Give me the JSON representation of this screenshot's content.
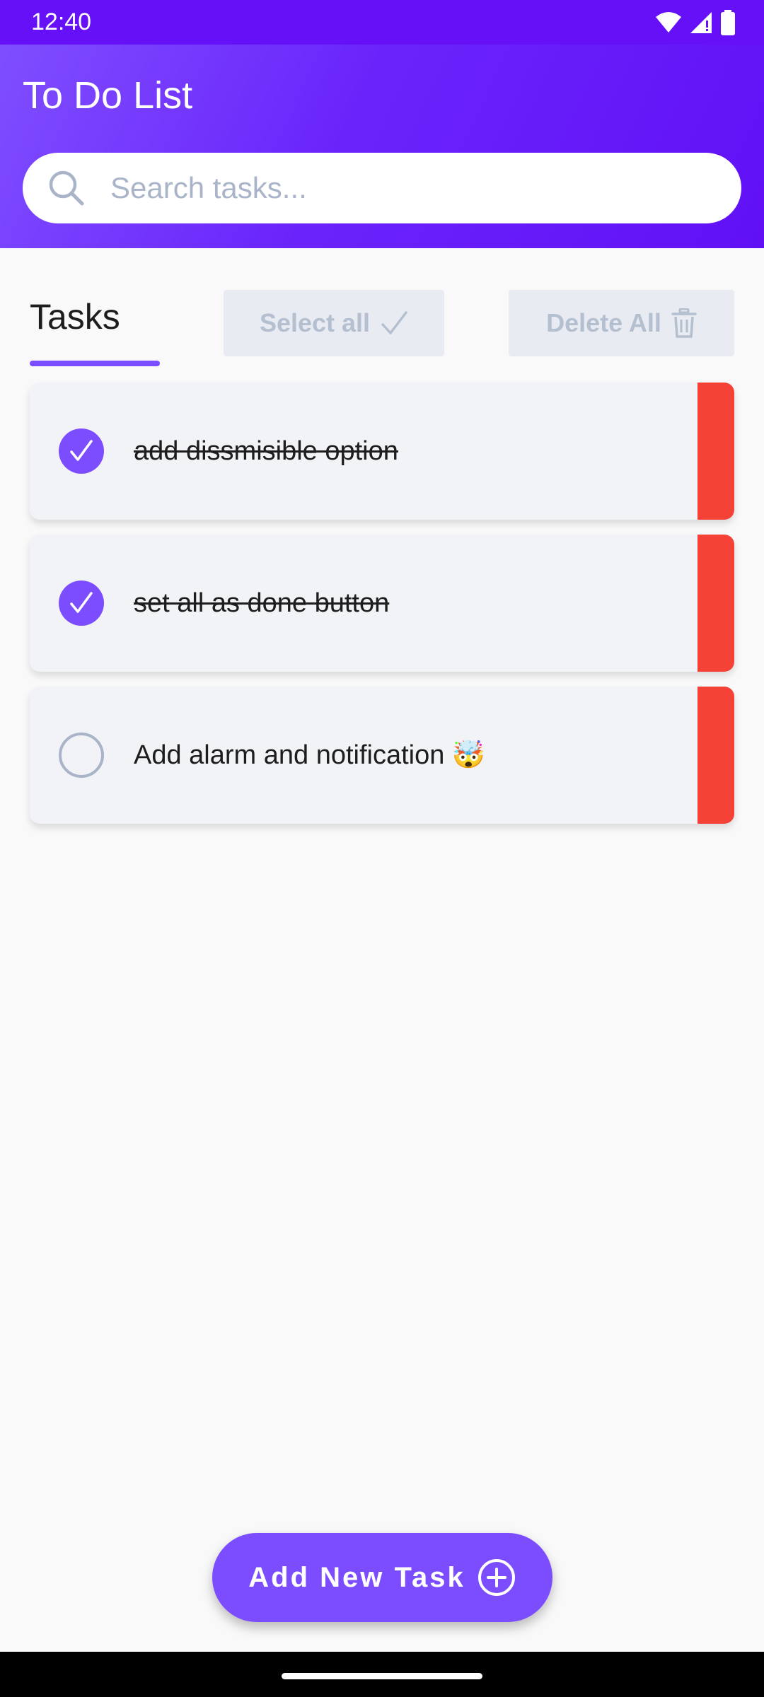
{
  "status_bar": {
    "time": "12:40",
    "icons": [
      "wifi-icon",
      "cell-signal-icon",
      "battery-icon"
    ]
  },
  "header": {
    "title": "To Do List",
    "search": {
      "placeholder": "Search tasks...",
      "value": ""
    }
  },
  "tabs": [
    {
      "label": "Tasks",
      "active": true
    }
  ],
  "actions": {
    "select_all_label": "Select all",
    "select_all_icon": "checkmark-icon",
    "delete_all_label": "Delete All",
    "delete_all_icon": "trash-icon"
  },
  "tasks": [
    {
      "text": "add dissmisible option",
      "done": true
    },
    {
      "text": "set all as done button",
      "done": true
    },
    {
      "text": "Add alarm and notification 🤯",
      "done": false
    }
  ],
  "fab": {
    "label": "Add New Task",
    "icon": "plus-circle-icon"
  },
  "colors": {
    "accent": "#7c4dff",
    "header_dark": "#6110f6",
    "delete_stripe": "#f44336",
    "muted": "#b4bfd0"
  }
}
